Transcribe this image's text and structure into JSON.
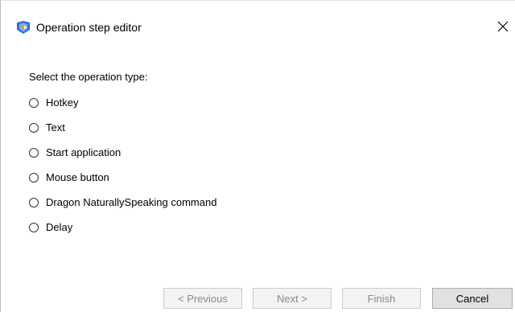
{
  "window": {
    "title": "Operation step editor",
    "app_icon": "dragon-app-icon",
    "close_icon": "close-icon",
    "close_glyph": "✕"
  },
  "prompt": "Select the operation type:",
  "options": [
    {
      "label": "Hotkey",
      "selected": false
    },
    {
      "label": "Text",
      "selected": false
    },
    {
      "label": "Start application",
      "selected": false
    },
    {
      "label": "Mouse button",
      "selected": false
    },
    {
      "label": "Dragon NaturallySpeaking command",
      "selected": false
    },
    {
      "label": "Delay",
      "selected": false
    }
  ],
  "buttons": {
    "previous": {
      "label": "< Previous",
      "enabled": false
    },
    "next": {
      "label": "Next >",
      "enabled": false
    },
    "finish": {
      "label": "Finish",
      "enabled": false
    },
    "cancel": {
      "label": "Cancel",
      "enabled": true
    }
  },
  "colors": {
    "disabled_text": "#8a8a8a",
    "icon_blue": "#2f6fd6",
    "icon_orange": "#e89a2c"
  }
}
